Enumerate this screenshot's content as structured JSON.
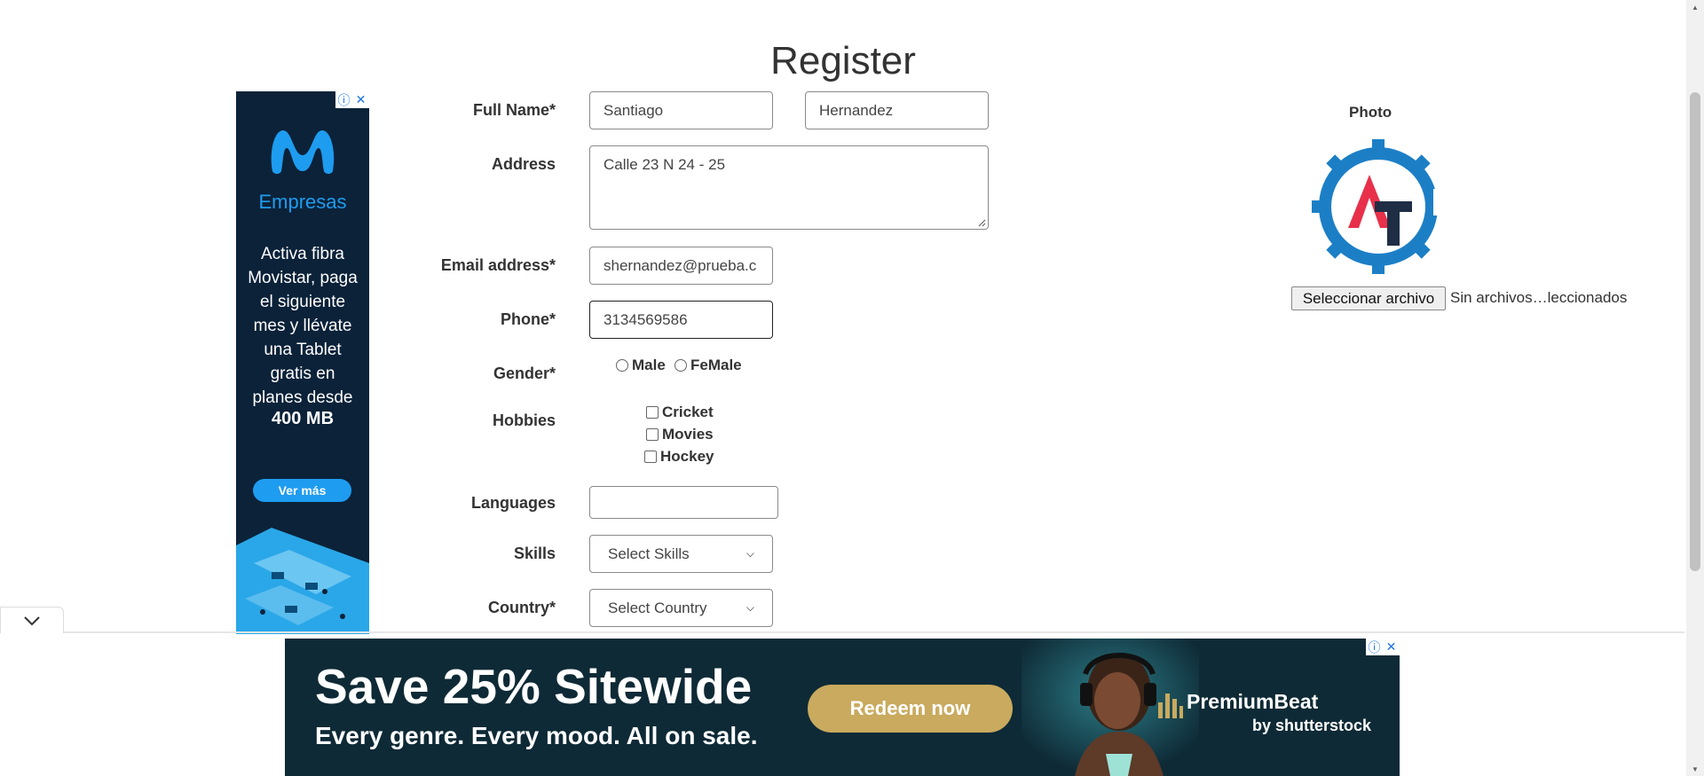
{
  "page": {
    "title": "Register"
  },
  "form": {
    "full_name_label": "Full Name*",
    "first_name_value": "Santiago",
    "last_name_value": "Hernandez",
    "address_label": "Address",
    "address_value": "Calle 23 N 24 - 25",
    "email_label": "Email address*",
    "email_value": "shernandez@prueba.c",
    "phone_label": "Phone*",
    "phone_value": "3134569586",
    "gender_label": "Gender*",
    "gender_options": [
      "Male",
      "FeMale"
    ],
    "hobbies_label": "Hobbies",
    "hobbies": [
      "Cricket",
      "Movies",
      "Hockey"
    ],
    "languages_label": "Languages",
    "languages_value": "",
    "skills_label": "Skills",
    "skills_selected": "Select Skills",
    "country_label": "Country*",
    "country_selected": "Select Country"
  },
  "photo": {
    "label": "Photo",
    "file_button": "Seleccionar archivo",
    "file_status": "Sin archivos…leccionados"
  },
  "left_ad": {
    "brand": "Empresas",
    "text_lines": [
      "Activa fibra",
      "Movistar, paga",
      "el siguiente",
      "mes y llévate",
      "una Tablet",
      "gratis en",
      "planes desde"
    ],
    "highlight": "400 MB",
    "cta": "Ver más",
    "colors": {
      "bg": "#0b2239",
      "accent": "#1e9cf0"
    }
  },
  "bottom_ad": {
    "headline": "Save 25% Sitewide",
    "subline": "Every genre. Every mood. All on sale.",
    "cta": "Redeem now",
    "brand": "PremiumBeat",
    "brand_sub": "by shutterstock",
    "colors": {
      "bg": "#0e2a36",
      "cta": "#c9aa5e"
    }
  },
  "icons": [
    "info-icon",
    "close-icon",
    "chevron-down-icon",
    "resize-grip-icon",
    "at-gear-logo",
    "movistar-m-logo",
    "premiumbeat-bars-logo"
  ]
}
